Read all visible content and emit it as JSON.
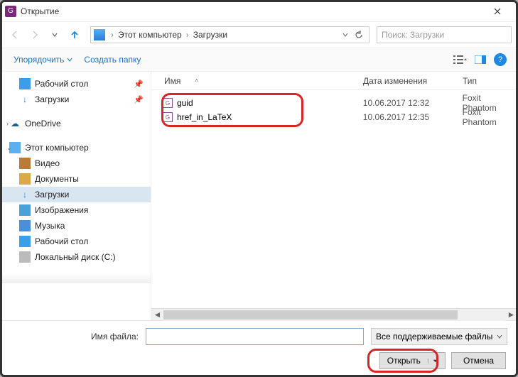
{
  "window": {
    "title": "Открытие"
  },
  "nav": {
    "crumbs": [
      "Этот компьютер",
      "Загрузки"
    ],
    "search_placeholder": "Поиск: Загрузки"
  },
  "toolbar": {
    "organize": "Упорядочить",
    "newfolder": "Создать папку"
  },
  "sidebar": {
    "quick": [
      {
        "label": "Рабочий стол",
        "icon": "ic-desktop",
        "pinned": true
      },
      {
        "label": "Загрузки",
        "icon": "ic-down",
        "pinned": true
      }
    ],
    "onedrive": "OneDrive",
    "thispc": "Этот компьютер",
    "pc_children": [
      {
        "label": "Видео",
        "icon": "ic-video"
      },
      {
        "label": "Документы",
        "icon": "ic-docs"
      },
      {
        "label": "Загрузки",
        "icon": "ic-down",
        "selected": true
      },
      {
        "label": "Изображения",
        "icon": "ic-images"
      },
      {
        "label": "Музыка",
        "icon": "ic-music"
      },
      {
        "label": "Рабочий стол",
        "icon": "ic-desktop"
      },
      {
        "label": "Локальный диск (C:)",
        "icon": "ic-disk"
      }
    ]
  },
  "columns": {
    "name": "Имя",
    "date": "Дата изменения",
    "type": "Тип"
  },
  "files": [
    {
      "name": "guid",
      "date": "10.06.2017 12:32",
      "type": "Foxit Phantom"
    },
    {
      "name": "href_in_LaTeX",
      "date": "10.06.2017 12:35",
      "type": "Foxit Phantom"
    }
  ],
  "footer": {
    "filename_label": "Имя файла:",
    "filename_value": "",
    "filter": "Все поддерживаемые файлы",
    "open": "Открыть",
    "cancel": "Отмена"
  }
}
